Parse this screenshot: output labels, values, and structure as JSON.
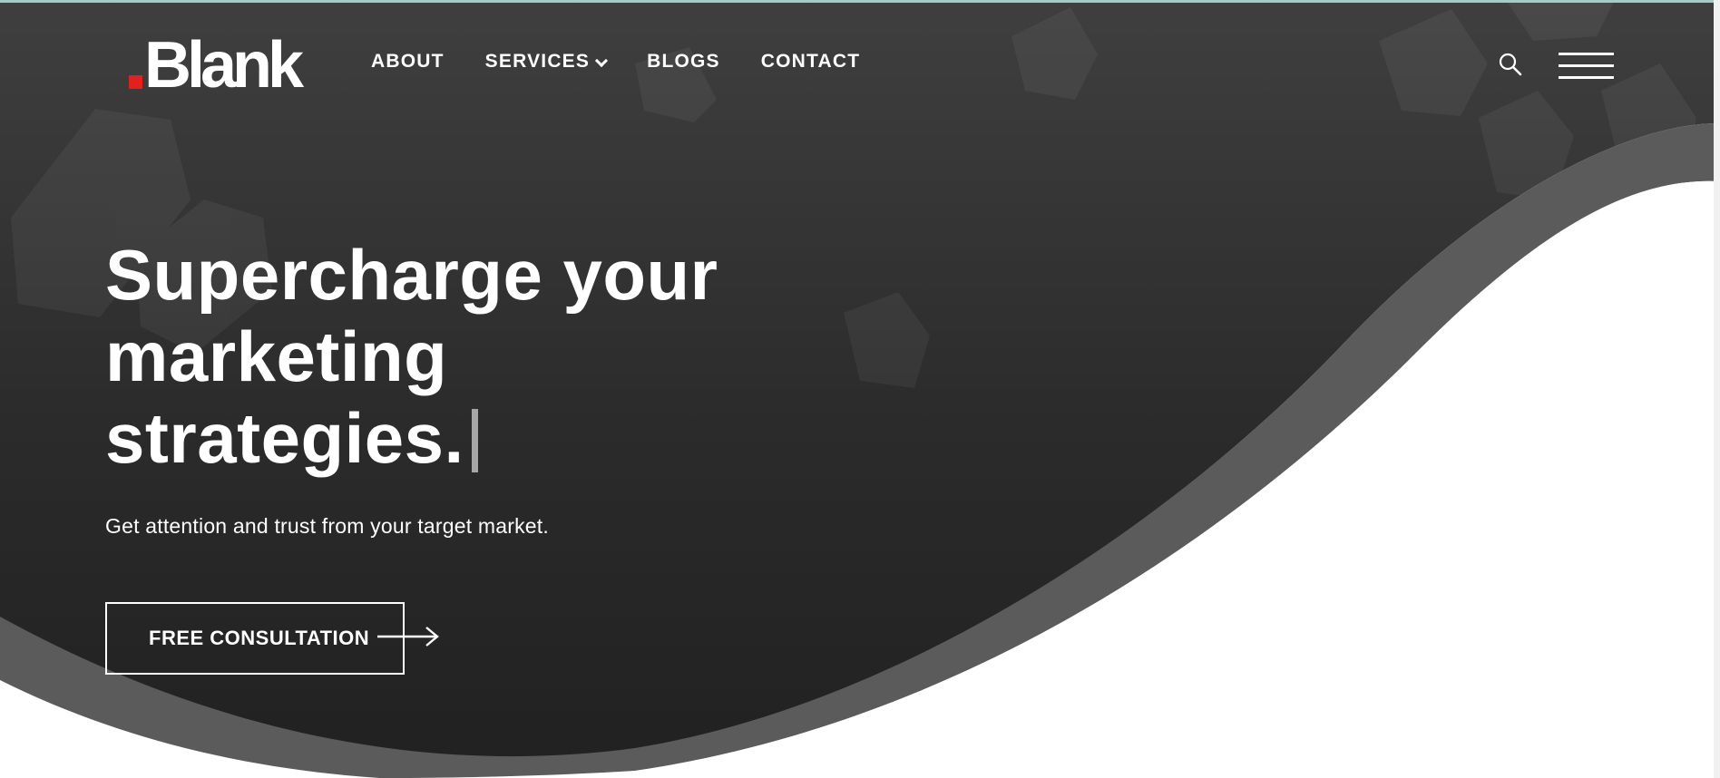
{
  "brand": {
    "logo_text": "Blank",
    "accent": "#e3201b"
  },
  "nav": {
    "items": [
      {
        "label": "ABOUT"
      },
      {
        "label": "SERVICES"
      },
      {
        "label": "BLOGS"
      },
      {
        "label": "CONTACT"
      }
    ],
    "search_icon": "search-icon",
    "menu_icon": "hamburger-menu-icon"
  },
  "hero": {
    "title_line1": "Supercharge your",
    "title_line2": "marketing",
    "title_line3": "strategies.",
    "subtitle": "Get attention and trust from your target market.",
    "cta_label": "FREE CONSULTATION",
    "cta_icon": "arrow-right-icon"
  },
  "colors": {
    "hero_dark": "#232323",
    "hero_mid": "#3d3d3d",
    "wave_band": "#5a5a5a",
    "text": "#ffffff"
  }
}
